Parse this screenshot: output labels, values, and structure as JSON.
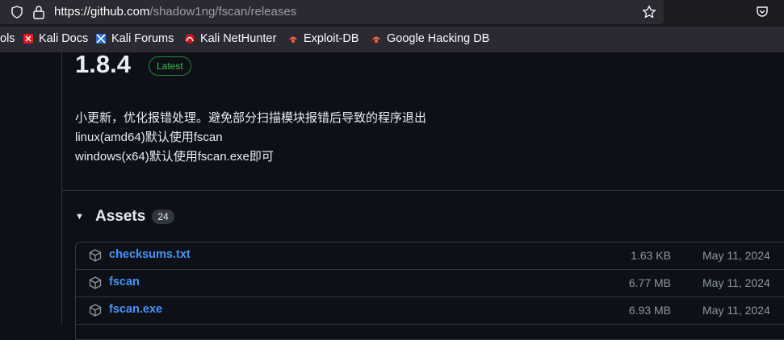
{
  "browser": {
    "url_host": "https://github.com",
    "url_path": "/shadow1ng/fscan/releases"
  },
  "bookmarks": [
    {
      "label": "ols",
      "icon": "folder-icon"
    },
    {
      "label": "Kali Docs",
      "icon": "kali-docs-icon"
    },
    {
      "label": "Kali Forums",
      "icon": "kali-forums-icon"
    },
    {
      "label": "Kali NetHunter",
      "icon": "nethunter-icon"
    },
    {
      "label": "Exploit-DB",
      "icon": "exploit-db-icon"
    },
    {
      "label": "Google Hacking DB",
      "icon": "ghdb-icon"
    }
  ],
  "release": {
    "version": "1.8.4",
    "badge": "Latest",
    "notes": [
      "小更新，优化报错处理。避免部分扫描模块报错后导致的程序退出",
      "linux(amd64)默认使用fscan",
      "windows(x64)默认使用fscan.exe即可"
    ]
  },
  "assets": {
    "title": "Assets",
    "count": "24",
    "items": [
      {
        "name": "checksums.txt",
        "size": "1.63 KB",
        "date": "May 11, 2024"
      },
      {
        "name": "fscan",
        "size": "6.77 MB",
        "date": "May 11, 2024"
      },
      {
        "name": "fscan.exe",
        "size": "6.93 MB",
        "date": "May 11, 2024"
      }
    ]
  },
  "colors": {
    "accent_link": "#4493f8",
    "latest_green": "#3fb950",
    "background": "#0d1117"
  }
}
